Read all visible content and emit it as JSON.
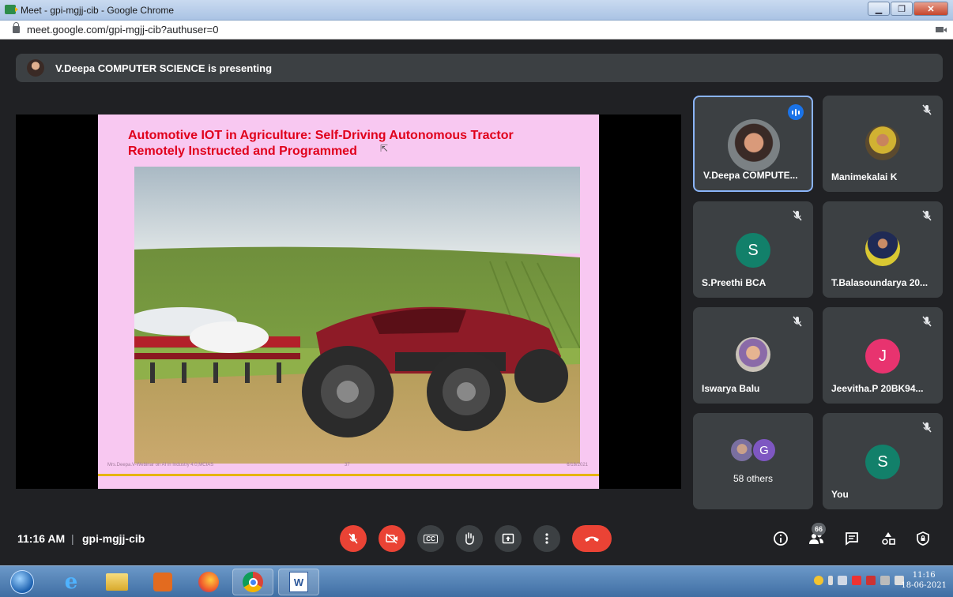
{
  "browser": {
    "window_title": "Meet - gpi-mgjj-cib - Google Chrome",
    "url": "meet.google.com/gpi-mgjj-cib?authuser=0"
  },
  "meet": {
    "presenting_text": "V.Deepa COMPUTER SCIENCE is presenting",
    "slide": {
      "title_line1": "Automotive IOT in Agriculture: Self-Driving Autonomous  Tractor",
      "title_line2": "Remotely Instructed and Programmed",
      "footer_left": "Mrs.Deepa.V-Webinar on AI in Industry 4.0,MCIAS",
      "footer_center": "37",
      "footer_right": "6/18/2021"
    },
    "participants": [
      {
        "name": "V.Deepa COMPUTE...",
        "speaking": true
      },
      {
        "name": "Manimekalai K",
        "muted": true
      },
      {
        "name": "S.Preethi BCA",
        "initial": "S",
        "muted": true
      },
      {
        "name": "T.Balasoundarya 20...",
        "muted": true
      },
      {
        "name": "Iswarya Balu",
        "muted": true
      },
      {
        "name": "Jeevitha.P 20BK94...",
        "initial": "J",
        "muted": true
      },
      {
        "name": "58 others",
        "initial": "G"
      },
      {
        "name": "You",
        "initial": "S",
        "muted": true
      }
    ],
    "bottom": {
      "time": "11:16 AM",
      "separator": "|",
      "meeting_code": "gpi-mgjj-cib",
      "people_count": "66",
      "cc_label": "CC"
    }
  },
  "taskbar": {
    "clock_time": "11:16",
    "clock_date": "18-06-2021"
  },
  "colors": {
    "accent": "#8ab4f8",
    "danger": "#ea4335",
    "tile_bg": "#3c4043",
    "slide_bg": "#f8c8f1",
    "slide_title": "#e0001b"
  }
}
